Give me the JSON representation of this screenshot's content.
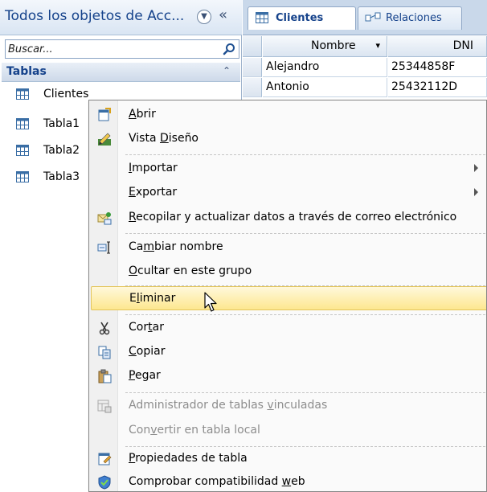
{
  "nav": {
    "title": "Todos los objetos de Acc...",
    "search_placeholder": "Buscar...",
    "group_title": "Tablas",
    "items": [
      {
        "label": "Clientes"
      },
      {
        "label": "Tabla1"
      },
      {
        "label": "Tabla2"
      },
      {
        "label": "Tabla3"
      }
    ]
  },
  "tabs": [
    {
      "label": "Clientes"
    },
    {
      "label": "Relaciones"
    }
  ],
  "datasheet": {
    "columns": [
      "Nombre",
      "DNI"
    ],
    "rows": [
      {
        "nombre": "Alejandro",
        "dni": "25344858F"
      },
      {
        "nombre": "Antonio",
        "dni": "25432112D"
      }
    ]
  },
  "context_menu": {
    "items": [
      {
        "pre": "",
        "key": "A",
        "post": "brir",
        "icon": "open-icon",
        "enabled": true
      },
      {
        "pre": "Vista ",
        "key": "D",
        "post": "iseño",
        "icon": "design-view-icon",
        "enabled": true
      },
      {
        "pre": "",
        "key": "I",
        "post": "mportar",
        "icon": "",
        "enabled": true,
        "submenu": true
      },
      {
        "pre": "",
        "key": "E",
        "post": "xportar",
        "icon": "",
        "enabled": true,
        "submenu": true
      },
      {
        "pre": "",
        "key": "R",
        "post": "ecopilar y actualizar datos a través de correo electrónico",
        "icon": "collect-data-icon",
        "enabled": true
      },
      {
        "pre": "Ca",
        "key": "m",
        "post": "biar nombre",
        "icon": "rename-icon",
        "enabled": true
      },
      {
        "pre": "",
        "key": "O",
        "post": "cultar en este grupo",
        "icon": "",
        "enabled": true
      },
      {
        "pre": "E",
        "key": "l",
        "post": "iminar",
        "icon": "",
        "enabled": true,
        "hover": true
      },
      {
        "pre": "Cor",
        "key": "t",
        "post": "ar",
        "icon": "cut-icon",
        "enabled": true
      },
      {
        "pre": "",
        "key": "C",
        "post": "opiar",
        "icon": "copy-icon",
        "enabled": true
      },
      {
        "pre": "",
        "key": "P",
        "post": "egar",
        "icon": "paste-icon",
        "enabled": true
      },
      {
        "pre": "Administrador de tablas ",
        "key": "v",
        "post": "inculadas",
        "icon": "linked-table-manager-icon",
        "enabled": false
      },
      {
        "pre": "Con",
        "key": "v",
        "post": "ertir en tabla local",
        "icon": "",
        "enabled": false
      },
      {
        "pre": "",
        "key": "P",
        "post": "ropiedades de tabla",
        "icon": "table-properties-icon",
        "enabled": true
      },
      {
        "pre": "Comprobar compatibilidad ",
        "key": "w",
        "post": "eb",
        "icon": "web-compat-icon",
        "enabled": true
      }
    ]
  },
  "colors": {
    "accent": "#15428b",
    "hover_fill": "#fde78f",
    "hover_border": "#e3c55a"
  }
}
